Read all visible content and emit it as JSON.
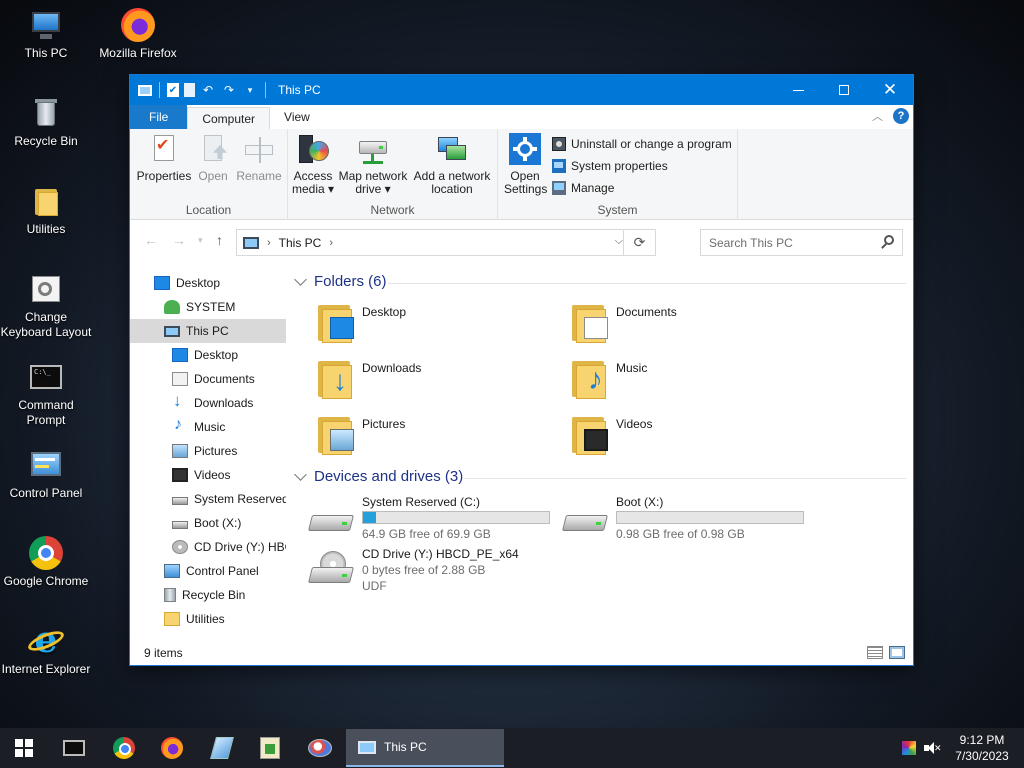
{
  "desktop": {
    "icons": [
      {
        "label": "This PC",
        "icon": "pc-icon"
      },
      {
        "label": "Mozilla Firefox",
        "icon": "firefox-icon"
      },
      {
        "label": "Recycle Bin",
        "icon": "recycle-bin-icon"
      },
      {
        "label": "Utilities",
        "icon": "folder-icon"
      },
      {
        "label": "Change Keyboard Layout",
        "icon": "keyboard-layout-icon"
      },
      {
        "label": "Command Prompt",
        "icon": "command-prompt-icon"
      },
      {
        "label": "Control Panel",
        "icon": "control-panel-icon"
      },
      {
        "label": "Google Chrome",
        "icon": "chrome-icon"
      },
      {
        "label": "Internet Explorer",
        "icon": "internet-explorer-icon"
      }
    ]
  },
  "window": {
    "title": "This PC",
    "controls": {
      "minimize": "minimize",
      "maximize": "maximize",
      "close": "✕"
    }
  },
  "ribbon": {
    "tabs": {
      "file": "File",
      "computer": "Computer",
      "view": "View"
    },
    "help": "?",
    "groups": {
      "location": {
        "label": "Location",
        "properties": "Properties",
        "open": "Open",
        "rename": "Rename"
      },
      "network": {
        "label": "Network",
        "access_media_1": "Access",
        "access_media_2": "media ▾",
        "map_drive_1": "Map network",
        "map_drive_2": "drive ▾",
        "add_location_1": "Add a network",
        "add_location_2": "location"
      },
      "system": {
        "label": "System",
        "open_settings_1": "Open",
        "open_settings_2": "Settings",
        "uninstall": "Uninstall or change a program",
        "system_properties": "System properties",
        "manage": "Manage"
      }
    }
  },
  "address": {
    "path": "This PC",
    "search_placeholder": "Search This PC"
  },
  "navpane": {
    "items": [
      {
        "label": "Desktop",
        "icon": "desktop-icon"
      },
      {
        "label": "SYSTEM",
        "icon": "user-icon"
      },
      {
        "label": "This PC",
        "icon": "pc-icon",
        "selected": true
      },
      {
        "label": "Desktop",
        "icon": "desktop-icon"
      },
      {
        "label": "Documents",
        "icon": "documents-icon"
      },
      {
        "label": "Downloads",
        "icon": "downloads-icon"
      },
      {
        "label": "Music",
        "icon": "music-icon"
      },
      {
        "label": "Pictures",
        "icon": "pictures-icon"
      },
      {
        "label": "Videos",
        "icon": "videos-icon"
      },
      {
        "label": "System Reserved (",
        "icon": "drive-icon"
      },
      {
        "label": "Boot (X:)",
        "icon": "drive-icon"
      },
      {
        "label": "CD Drive (Y:) HBC",
        "icon": "cd-drive-icon"
      },
      {
        "label": "Control Panel",
        "icon": "control-panel-icon"
      },
      {
        "label": "Recycle Bin",
        "icon": "recycle-bin-icon"
      },
      {
        "label": "Utilities",
        "icon": "folder-icon"
      }
    ]
  },
  "content": {
    "folders_header": "Folders (6)",
    "folders": [
      {
        "name": "Desktop"
      },
      {
        "name": "Documents"
      },
      {
        "name": "Downloads"
      },
      {
        "name": "Music"
      },
      {
        "name": "Pictures"
      },
      {
        "name": "Videos"
      }
    ],
    "drives_header": "Devices and drives (3)",
    "drives": [
      {
        "name": "System Reserved (C:)",
        "free": "64.9 GB free of 69.9 GB",
        "used_fraction": 0.072
      },
      {
        "name": "Boot (X:)",
        "free": "0.98 GB free of 0.98 GB",
        "used_fraction": 0.0
      },
      {
        "name": "CD Drive (Y:) HBCD_PE_x64",
        "free": "0 bytes free of 2.88 GB",
        "fs": "UDF"
      }
    ]
  },
  "status": {
    "items_count": "9 items"
  },
  "taskbar": {
    "active_task": "This PC",
    "time": "9:12 PM",
    "date": "7/30/2023"
  }
}
